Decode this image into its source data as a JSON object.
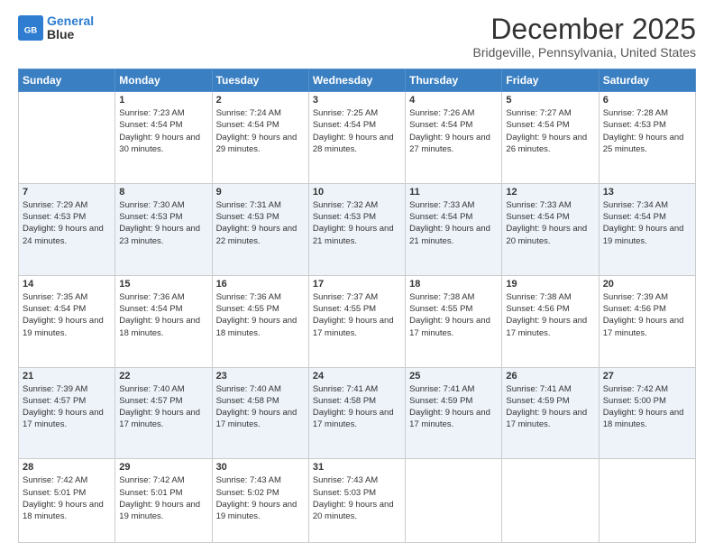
{
  "header": {
    "logo_line1": "General",
    "logo_line2": "Blue",
    "month_title": "December 2025",
    "location": "Bridgeville, Pennsylvania, United States"
  },
  "weekdays": [
    "Sunday",
    "Monday",
    "Tuesday",
    "Wednesday",
    "Thursday",
    "Friday",
    "Saturday"
  ],
  "weeks": [
    [
      {
        "day": "",
        "empty": true
      },
      {
        "day": "1",
        "sunrise": "7:23 AM",
        "sunset": "4:54 PM",
        "daylight": "9 hours and 30 minutes."
      },
      {
        "day": "2",
        "sunrise": "7:24 AM",
        "sunset": "4:54 PM",
        "daylight": "9 hours and 29 minutes."
      },
      {
        "day": "3",
        "sunrise": "7:25 AM",
        "sunset": "4:54 PM",
        "daylight": "9 hours and 28 minutes."
      },
      {
        "day": "4",
        "sunrise": "7:26 AM",
        "sunset": "4:54 PM",
        "daylight": "9 hours and 27 minutes."
      },
      {
        "day": "5",
        "sunrise": "7:27 AM",
        "sunset": "4:54 PM",
        "daylight": "9 hours and 26 minutes."
      },
      {
        "day": "6",
        "sunrise": "7:28 AM",
        "sunset": "4:53 PM",
        "daylight": "9 hours and 25 minutes."
      }
    ],
    [
      {
        "day": "7",
        "sunrise": "7:29 AM",
        "sunset": "4:53 PM",
        "daylight": "9 hours and 24 minutes."
      },
      {
        "day": "8",
        "sunrise": "7:30 AM",
        "sunset": "4:53 PM",
        "daylight": "9 hours and 23 minutes."
      },
      {
        "day": "9",
        "sunrise": "7:31 AM",
        "sunset": "4:53 PM",
        "daylight": "9 hours and 22 minutes."
      },
      {
        "day": "10",
        "sunrise": "7:32 AM",
        "sunset": "4:53 PM",
        "daylight": "9 hours and 21 minutes."
      },
      {
        "day": "11",
        "sunrise": "7:33 AM",
        "sunset": "4:54 PM",
        "daylight": "9 hours and 21 minutes."
      },
      {
        "day": "12",
        "sunrise": "7:33 AM",
        "sunset": "4:54 PM",
        "daylight": "9 hours and 20 minutes."
      },
      {
        "day": "13",
        "sunrise": "7:34 AM",
        "sunset": "4:54 PM",
        "daylight": "9 hours and 19 minutes."
      }
    ],
    [
      {
        "day": "14",
        "sunrise": "7:35 AM",
        "sunset": "4:54 PM",
        "daylight": "9 hours and 19 minutes."
      },
      {
        "day": "15",
        "sunrise": "7:36 AM",
        "sunset": "4:54 PM",
        "daylight": "9 hours and 18 minutes."
      },
      {
        "day": "16",
        "sunrise": "7:36 AM",
        "sunset": "4:55 PM",
        "daylight": "9 hours and 18 minutes."
      },
      {
        "day": "17",
        "sunrise": "7:37 AM",
        "sunset": "4:55 PM",
        "daylight": "9 hours and 17 minutes."
      },
      {
        "day": "18",
        "sunrise": "7:38 AM",
        "sunset": "4:55 PM",
        "daylight": "9 hours and 17 minutes."
      },
      {
        "day": "19",
        "sunrise": "7:38 AM",
        "sunset": "4:56 PM",
        "daylight": "9 hours and 17 minutes."
      },
      {
        "day": "20",
        "sunrise": "7:39 AM",
        "sunset": "4:56 PM",
        "daylight": "9 hours and 17 minutes."
      }
    ],
    [
      {
        "day": "21",
        "sunrise": "7:39 AM",
        "sunset": "4:57 PM",
        "daylight": "9 hours and 17 minutes."
      },
      {
        "day": "22",
        "sunrise": "7:40 AM",
        "sunset": "4:57 PM",
        "daylight": "9 hours and 17 minutes."
      },
      {
        "day": "23",
        "sunrise": "7:40 AM",
        "sunset": "4:58 PM",
        "daylight": "9 hours and 17 minutes."
      },
      {
        "day": "24",
        "sunrise": "7:41 AM",
        "sunset": "4:58 PM",
        "daylight": "9 hours and 17 minutes."
      },
      {
        "day": "25",
        "sunrise": "7:41 AM",
        "sunset": "4:59 PM",
        "daylight": "9 hours and 17 minutes."
      },
      {
        "day": "26",
        "sunrise": "7:41 AM",
        "sunset": "4:59 PM",
        "daylight": "9 hours and 17 minutes."
      },
      {
        "day": "27",
        "sunrise": "7:42 AM",
        "sunset": "5:00 PM",
        "daylight": "9 hours and 18 minutes."
      }
    ],
    [
      {
        "day": "28",
        "sunrise": "7:42 AM",
        "sunset": "5:01 PM",
        "daylight": "9 hours and 18 minutes."
      },
      {
        "day": "29",
        "sunrise": "7:42 AM",
        "sunset": "5:01 PM",
        "daylight": "9 hours and 19 minutes."
      },
      {
        "day": "30",
        "sunrise": "7:43 AM",
        "sunset": "5:02 PM",
        "daylight": "9 hours and 19 minutes."
      },
      {
        "day": "31",
        "sunrise": "7:43 AM",
        "sunset": "5:03 PM",
        "daylight": "9 hours and 20 minutes."
      },
      {
        "day": "",
        "empty": true
      },
      {
        "day": "",
        "empty": true
      },
      {
        "day": "",
        "empty": true
      }
    ]
  ],
  "labels": {
    "sunrise_prefix": "Sunrise: ",
    "sunset_prefix": "Sunset: ",
    "daylight_prefix": "Daylight: "
  }
}
